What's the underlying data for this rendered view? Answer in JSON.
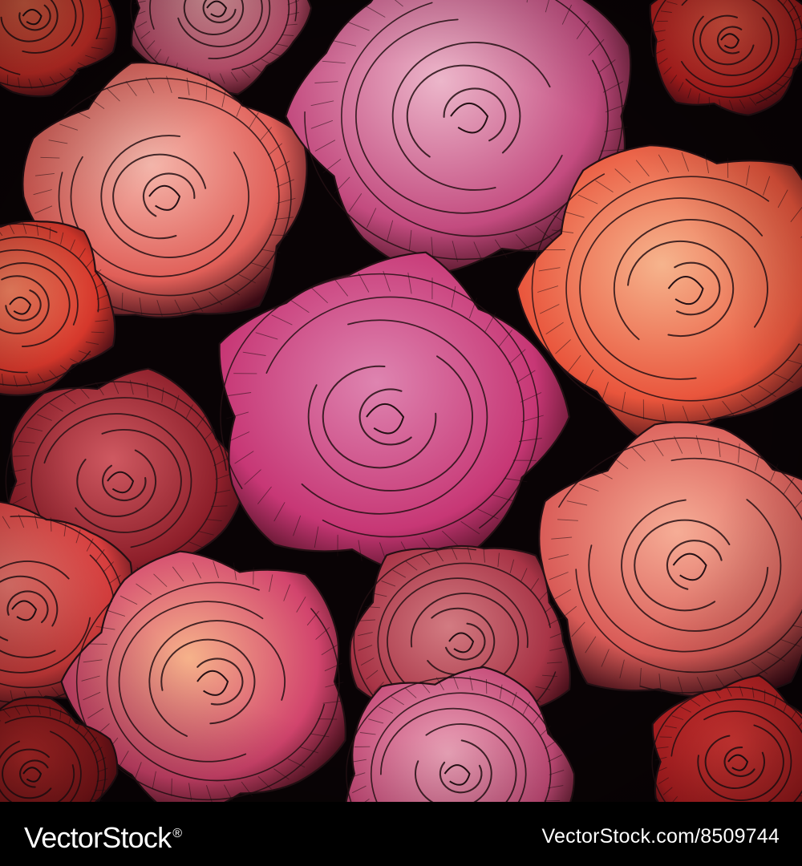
{
  "image": {
    "subject": "roses",
    "palette": {
      "background": "#090305",
      "red": "#cf2f28",
      "coral": "#f16c57",
      "peach": "#f5a98e",
      "pink": "#d44b86",
      "magenta": "#c8357c",
      "rose": "#b9445c",
      "ink": "#241014"
    }
  },
  "footer": {
    "brand": "VectorStock",
    "registered_mark": "®",
    "image_id": "VectorStock.com/8509744"
  }
}
